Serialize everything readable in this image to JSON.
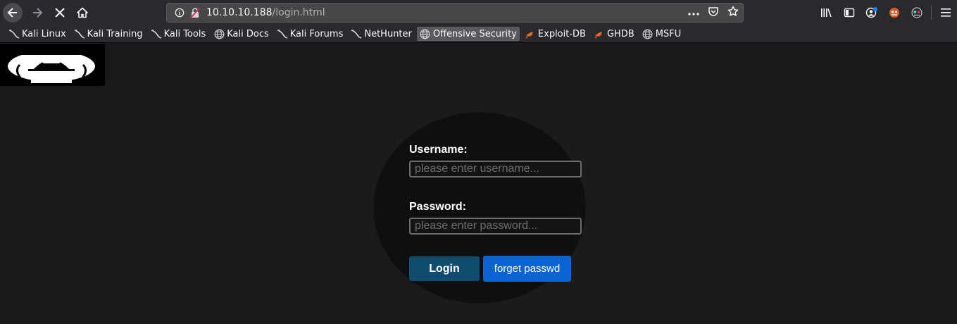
{
  "browser": {
    "url_host": "10.10.10.188",
    "url_path": "/login.html",
    "icons": {
      "back": "back-arrow-icon",
      "forward": "forward-arrow-icon",
      "stop": "stop-icon",
      "home": "home-icon",
      "info": "info-icon",
      "insecure": "insecure-lock-icon",
      "page_actions": "more-icon",
      "pocket": "pocket-icon",
      "bookmark_star": "star-icon",
      "library": "library-icon",
      "sidebar": "sidebar-icon",
      "account": "account-icon",
      "ext1": "extension-icon",
      "ext2": "extension-icon",
      "menu": "hamburger-menu-icon"
    }
  },
  "bookmarks": [
    {
      "label": "Kali Linux",
      "icon": "kali-icon"
    },
    {
      "label": "Kali Training",
      "icon": "kali-icon"
    },
    {
      "label": "Kali Tools",
      "icon": "kali-icon"
    },
    {
      "label": "Kali Docs",
      "icon": "globe-icon"
    },
    {
      "label": "Kali Forums",
      "icon": "kali-icon"
    },
    {
      "label": "NetHunter",
      "icon": "kali-icon"
    },
    {
      "label": "Offensive Security",
      "icon": "globe-icon"
    },
    {
      "label": "Exploit-DB",
      "icon": "exploitdb-icon"
    },
    {
      "label": "GHDB",
      "icon": "exploitdb-icon"
    },
    {
      "label": "MSFU",
      "icon": "globe-icon"
    }
  ],
  "page": {
    "username_label": "Username:",
    "username_placeholder": "please enter username...",
    "password_label": "Password:",
    "password_placeholder": "please enter password...",
    "login_label": "Login",
    "forget_label": "forget passwd"
  },
  "colors": {
    "page_bg": "#1b1b1e",
    "login_button": "#0f4c6e",
    "forget_button": "#0b62d3"
  }
}
